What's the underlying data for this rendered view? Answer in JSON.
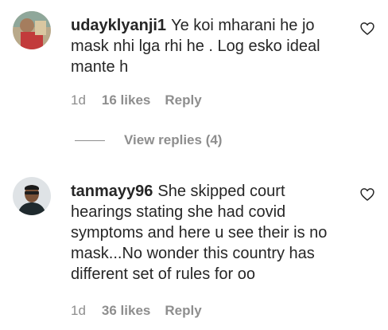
{
  "comments": [
    {
      "username": "udayklyanji1",
      "text": "Ye koi mharani he jo mask nhi lga rhi he . Log esko ideal mante h",
      "time": "1d",
      "likes": "16 likes",
      "reply": "Reply"
    },
    {
      "username": "tanmayy96",
      "text": "She skipped court hearings stating she had covid symptoms and here u see their is no mask...No wonder this country has different set of rules for oo",
      "time": "1d",
      "likes": "36 likes",
      "reply": "Reply"
    }
  ],
  "view_replies": {
    "label": "View replies (4)"
  },
  "icons": {
    "like": "heart-outline-icon"
  },
  "colors": {
    "primary_text": "#262626",
    "secondary_text": "#8e8e8e"
  }
}
